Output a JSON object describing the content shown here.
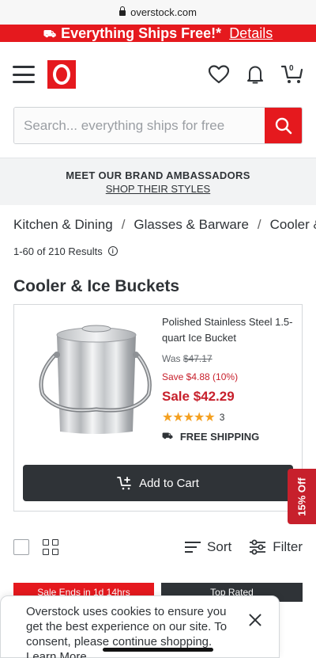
{
  "browser": {
    "url": "overstock.com"
  },
  "promo": {
    "text": "Everything Ships Free!*",
    "link": "Details"
  },
  "header": {
    "cart_count": "0"
  },
  "search": {
    "placeholder": "Search... everything ships for free"
  },
  "ambassadors": {
    "title": "MEET OUR BRAND AMBASSADORS",
    "link": "SHOP THEIR STYLES"
  },
  "breadcrumb": [
    "Kitchen & Dining",
    "Glasses & Barware",
    "Cooler & Ice Buckets"
  ],
  "results": {
    "text": "1-60 of 210 Results"
  },
  "page_title": "Cooler & Ice Buckets",
  "product": {
    "name": "Polished Stainless Steel 1.5-quart Ice Bucket",
    "was_label": "Was",
    "was_price": "$47.17",
    "save": "Save $4.88 (10%)",
    "sale": "Sale $42.29",
    "stars": "★★★★★",
    "review_count": "3",
    "shipping": "FREE SHIPPING",
    "add_to_cart": "Add to Cart"
  },
  "off_tab": "15% Off",
  "toolbar": {
    "sort": "Sort",
    "filter": "Filter"
  },
  "badges": {
    "sale_ends": "Sale Ends in 1d 14hrs",
    "top_rated": "Top Rated"
  },
  "cookie": {
    "text": "Overstock uses cookies to ensure you get the best experience on our site. To consent, please continue shopping.",
    "learn_more": "Learn More"
  },
  "colors": {
    "brand_red": "#e5191e",
    "price_red": "#c7202c",
    "dark": "#2f3337",
    "star": "#f4a020"
  }
}
